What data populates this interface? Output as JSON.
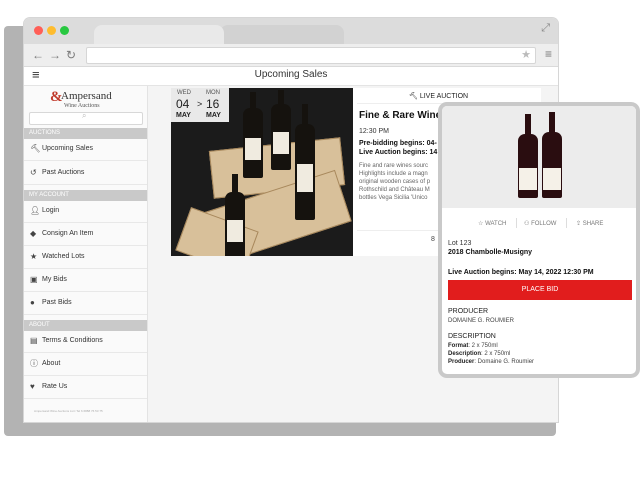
{
  "app": {
    "title": "Upcoming Sales"
  },
  "logo": {
    "symbol": "&",
    "name": "Ampersand",
    "subtitle": "Wine Auctions"
  },
  "sidebar": {
    "sections": {
      "auctions": "AUCTIONS",
      "account": "MY ACCOUNT",
      "about": "ABOUT"
    },
    "items": [
      {
        "label": "Upcoming Sales",
        "icon": "gavel-icon"
      },
      {
        "label": "Past Auctions",
        "icon": "history-icon"
      },
      {
        "label": "Login",
        "icon": "user-icon"
      },
      {
        "label": "Consign An Item",
        "icon": "tag-icon"
      },
      {
        "label": "Watched Lots",
        "icon": "star-icon"
      },
      {
        "label": "My Bids",
        "icon": "bids-icon"
      },
      {
        "label": "Past Bids",
        "icon": "dollar-icon"
      },
      {
        "label": "Terms & Conditions",
        "icon": "document-icon"
      },
      {
        "label": "About",
        "icon": "info-icon"
      },
      {
        "label": "Rate Us",
        "icon": "heart-icon"
      }
    ],
    "footnote": "Ampersand Wine Auctions LLC Tel 6 6888 76 53 75"
  },
  "auction": {
    "date_start": {
      "dow": "WED",
      "day": "04",
      "month": "MAY"
    },
    "date_end": {
      "dow": "MON",
      "day": "16",
      "month": "MAY"
    },
    "date_sep": ">",
    "type_label": "LIVE AUCTION",
    "title": "Fine & Rare Wines",
    "time": "12:30 PM",
    "prebid": "Pre-bidding begins: 04-",
    "live": "Live Auction begins: 14",
    "desc_lines": [
      "Fine and rare wines sourc",
      "Highlights include a magn",
      "original wooden cases of p",
      "Rothschild and Château M",
      "bottles Vega Sicilia 'Unico"
    ],
    "more": "8"
  },
  "lot": {
    "actions": {
      "watch": "WATCH",
      "follow": "FOLLOW",
      "share": "SHARE"
    },
    "lot_number": "Lot 123",
    "name": "2018 Chambolle-Musigny",
    "live_begins": "Live Auction begins: May 14, 2022 12:30 PM",
    "bid_label": "PLACE BID",
    "producer_heading": "PRODUCER",
    "producer": "DOMAINE G. ROUMIER",
    "description_heading": "DESCRIPTION",
    "format_label": "Format",
    "format": ": 2 x 750ml",
    "description_label": "Description",
    "description": ": 2 x 750ml",
    "producer_label": "Producer",
    "producer_value": ": Domaine G. Roumier"
  },
  "colors": {
    "accent": "#e11d1d",
    "brand": "#c0392b"
  }
}
